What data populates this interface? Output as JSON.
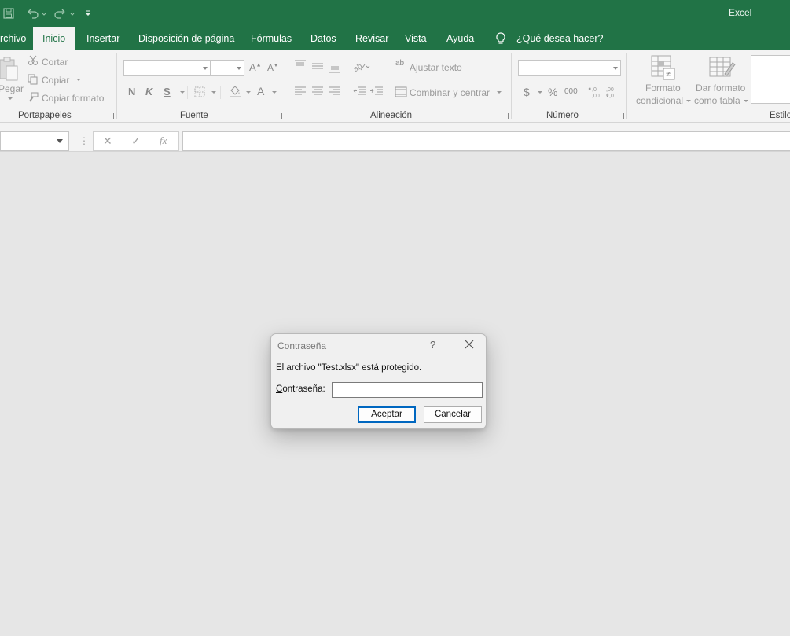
{
  "app": {
    "title": "Excel"
  },
  "qat": {
    "save_icon": "save-icon",
    "undo_icon": "undo-icon",
    "redo_icon": "redo-icon",
    "customize_icon": "customize-qat-icon"
  },
  "tabs": [
    {
      "label": "rchivo",
      "active": false
    },
    {
      "label": "Inicio",
      "active": true
    },
    {
      "label": "Insertar",
      "active": false
    },
    {
      "label": "Disposición de página",
      "active": false
    },
    {
      "label": "Fórmulas",
      "active": false
    },
    {
      "label": "Datos",
      "active": false
    },
    {
      "label": "Revisar",
      "active": false
    },
    {
      "label": "Vista",
      "active": false
    },
    {
      "label": "Ayuda",
      "active": false
    }
  ],
  "tell_me": {
    "label": "¿Qué desea hacer?",
    "icon": "lightbulb-icon"
  },
  "ribbon": {
    "clipboard": {
      "group_label": "Portapapeles",
      "paste_label": "Pegar",
      "cut_label": "Cortar",
      "copy_label": "Copiar",
      "format_painter_label": "Copiar formato"
    },
    "font": {
      "group_label": "Fuente",
      "grow_font": "A",
      "shrink_font": "A",
      "bold": "N",
      "italic": "K",
      "underline": "S",
      "font_color": "A"
    },
    "alignment": {
      "group_label": "Alineación",
      "wrap_text_label": "Ajustar texto",
      "merge_center_label": "Combinar y centrar",
      "wrap_icon_text": "ab"
    },
    "number": {
      "group_label": "Número",
      "currency": "$",
      "percent": "%",
      "thousands": "000",
      "increase_decimal": "˂,0\n,00",
      "decrease_decimal": ",00\n˃,0"
    },
    "styles": {
      "group_label": "Estilos",
      "conditional_format_line1": "Formato",
      "conditional_format_line2": "condicional",
      "format_table_line1": "Dar formato",
      "format_table_line2": "como tabla"
    }
  },
  "formula_bar": {
    "dots": "⋮",
    "cancel_glyph": "✕",
    "enter_glyph": "✓",
    "fx_glyph": "fx"
  },
  "dialog": {
    "title": "Contraseña",
    "help_glyph": "?",
    "message": "El archivo \"Test.xlsx\" está protegido.",
    "password_label_first": "C",
    "password_label_rest": "ontraseña:",
    "password_value": "",
    "ok_label": "Aceptar",
    "cancel_label": "Cancelar"
  },
  "colors": {
    "brand": "#217346",
    "workspace": "#e6e6e6",
    "ribbon": "#f3f3f3",
    "primary_button_border": "#0067c0"
  }
}
